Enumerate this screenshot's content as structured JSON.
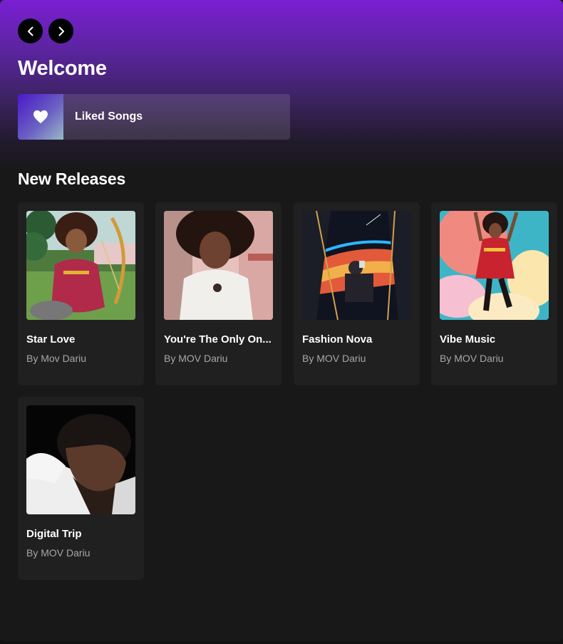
{
  "nav": {
    "back_icon": "chevron-left-icon",
    "forward_icon": "chevron-right-icon"
  },
  "page": {
    "title": "Welcome"
  },
  "liked": {
    "label": "Liked Songs",
    "icon": "heart-icon"
  },
  "section": {
    "title": "New Releases"
  },
  "releases": [
    {
      "title": "Star Love",
      "artist": "By Mov Dariu"
    },
    {
      "title": "You're The Only On...",
      "artist": "By MOV Dariu"
    },
    {
      "title": "Fashion Nova",
      "artist": "By MOV Dariu"
    },
    {
      "title": "Vibe Music",
      "artist": "By MOV Dariu"
    },
    {
      "title": "Digital Trip",
      "artist": "By MOV Dariu"
    }
  ],
  "colors": {
    "accent": "#7a1fd2",
    "background": "#121212",
    "card": "#202020",
    "muted_text": "#a7a7a7"
  }
}
